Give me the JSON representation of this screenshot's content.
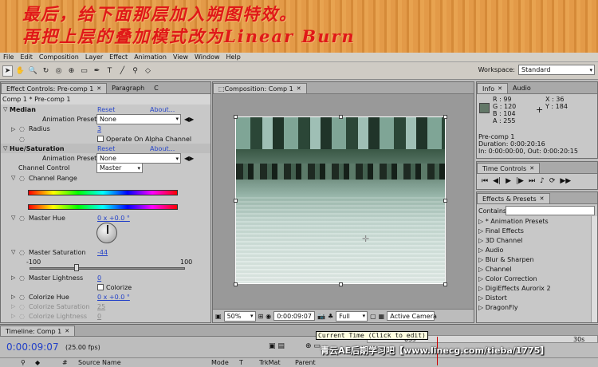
{
  "banner": {
    "line1": "最后，给下面那层加入朔图特效。",
    "line2": "再把上层的叠加模式改为Linear Burn"
  },
  "menu": [
    "File",
    "Edit",
    "Composition",
    "Layer",
    "Effect",
    "Animation",
    "View",
    "Window",
    "Help"
  ],
  "workspace": {
    "label": "Workspace:",
    "value": "Standard"
  },
  "effects_panel": {
    "tab": "Effect Controls: Pre-comp 1",
    "tab2": "Paragraph",
    "tab3": "C",
    "layer": "Comp 1 * Pre-comp 1",
    "median": {
      "name": "Median",
      "reset": "Reset",
      "about": "About...",
      "anim_label": "Animation Presets:",
      "anim_value": "None",
      "radius_label": "Radius",
      "radius_value": "3",
      "alpha": "Operate On Alpha Channel"
    },
    "hue": {
      "name": "Hue/Saturation",
      "reset": "Reset",
      "about": "About...",
      "anim_label": "Animation Presets:",
      "anim_value": "None",
      "channel_control_label": "Channel Control",
      "channel_control_value": "Master",
      "channel_range": "Channel Range",
      "master_hue": "Master Hue",
      "master_hue_value": "0 x +0.0 °",
      "master_sat": "Master Saturation",
      "master_sat_value": "-44",
      "min": "-100",
      "max": "100",
      "master_light": "Master Lightness",
      "master_light_value": "0",
      "colorize": "Colorize",
      "colorize_hue": "Colorize Hue",
      "colorize_hue_value": "0 x +0.0 °",
      "colorize_sat": "Colorize Saturation",
      "colorize_sat_value": "25",
      "colorize_light": "Colorize Lightness",
      "colorize_light_value": "0"
    }
  },
  "comp_panel": {
    "tab": "Composition: Comp 1",
    "zoom": "50%",
    "time": "0:00:09:07",
    "res": "Full",
    "camera": "Active Camera"
  },
  "info": {
    "tab": "Info",
    "tab2": "Audio",
    "r": "R : 99",
    "g": "G : 120",
    "b": "B : 104",
    "a": "A : 255",
    "x": "X : 36",
    "y": "Y : 184",
    "layer": "Pre-comp 1",
    "duration": "Duration: 0:00:20:16",
    "inout": "In: 0:00:00:00, Out: 0:00:20:15"
  },
  "time_controls": {
    "tab": "Time Controls"
  },
  "effects_presets": {
    "tab": "Effects & Presets",
    "contains": "Contains:",
    "items": [
      "* Animation Presets",
      "Final Effects",
      "3D Channel",
      "Audio",
      "Blur & Sharpen",
      "Channel",
      "Color Correction",
      "DigiEffects Aurorix 2",
      "Distort",
      "DragonFly"
    ]
  },
  "timeline": {
    "tab": "Timeline: Comp 1",
    "time": "0:00:09:07",
    "fps": "(25.00 fps)",
    "cols": [
      "#",
      "Source Name",
      "Mode",
      "T",
      "TrkMat",
      "Parent"
    ],
    "tooltip": "Current Time (Click to edit)",
    "ruler_a": "05s",
    "ruler_b": "30s"
  },
  "watermark": "青云AE后期学习吧【www.linecg.com/tieba/1775】",
  "colors": {
    "banner": "#e39a48",
    "banner_text": "#e01818",
    "accent": "#2240c8"
  }
}
